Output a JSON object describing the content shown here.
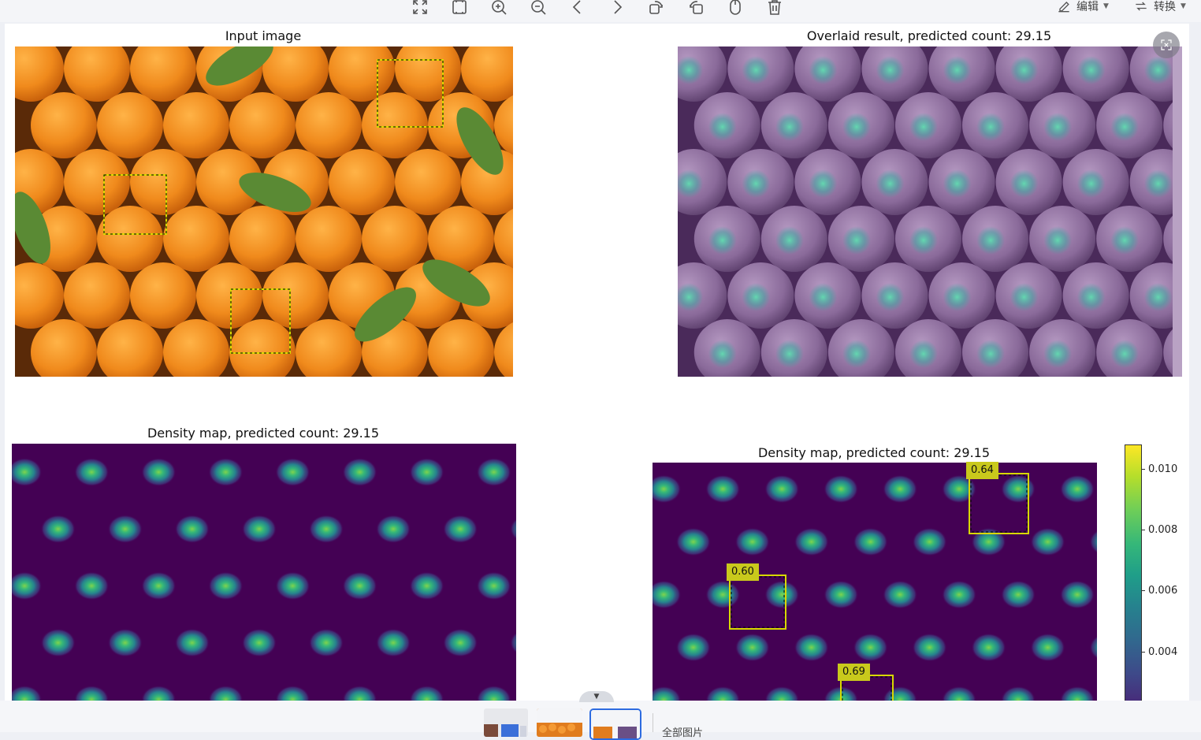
{
  "toolbar": {
    "icons": [
      "fit-screen-icon",
      "actual-size-icon",
      "zoom-in-icon",
      "zoom-out-icon",
      "previous-icon",
      "next-icon",
      "rotate-left-icon",
      "rotate-right-icon",
      "mirror-icon",
      "delete-icon"
    ],
    "edit_label": "编辑",
    "convert_label": "转换"
  },
  "panels": {
    "input_title": "Input image",
    "overlay_title": "Overlaid result, predicted count: 29.15",
    "density_title": "Density map, predicted count: 29.15",
    "density_boxes_title": "Density map, predicted count: 29.15"
  },
  "exemplar_scores": [
    "0.64",
    "0.60",
    "0.69"
  ],
  "colorbar": {
    "ticks": [
      "0.010",
      "0.008",
      "0.006",
      "0.004"
    ],
    "colormap": "viridis"
  },
  "colors": {
    "orange": "#f08a1c",
    "leaf": "#5a8a34",
    "overlay_purple": "#8a6a9a",
    "density_bg": "#440154",
    "box_yellow": "#d8d800",
    "accent_blue": "#2d6be0"
  },
  "bottom": {
    "all_images_label": "全部图片"
  }
}
